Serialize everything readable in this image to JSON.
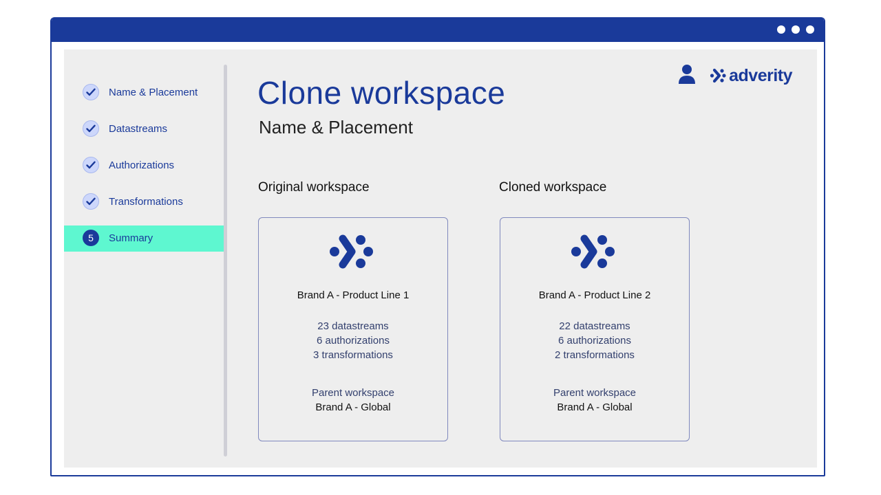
{
  "colors": {
    "brand_blue": "#1a3a9a",
    "active_step": "#5ef7d0",
    "panel_bg": "#eeeeee"
  },
  "sidebar": {
    "steps": [
      {
        "label": "Name & Placement",
        "status": "done",
        "icon": "check-icon"
      },
      {
        "label": "Datastreams",
        "status": "done",
        "icon": "check-icon"
      },
      {
        "label": "Authorizations",
        "status": "done",
        "icon": "check-icon"
      },
      {
        "label": "Transformations",
        "status": "done",
        "icon": "check-icon"
      },
      {
        "label": "Summary",
        "status": "current",
        "number": "5"
      }
    ]
  },
  "header": {
    "title": "Clone workspace",
    "subtitle": "Name & Placement",
    "user_icon": "user-icon",
    "brand": "adverity"
  },
  "original": {
    "heading": "Original workspace",
    "name": "Brand A - Product Line 1",
    "datastreams": "23 datastreams",
    "authorizations": "6 authorizations",
    "transformations": "3 transformations",
    "parent_label": "Parent workspace",
    "parent_value": "Brand A - Global"
  },
  "cloned": {
    "heading": "Cloned workspace",
    "name": "Brand A - Product Line 2",
    "datastreams": "22 datastreams",
    "authorizations": "6 authorizations",
    "transformations": "2 transformations",
    "parent_label": "Parent workspace",
    "parent_value": "Brand A - Global"
  }
}
